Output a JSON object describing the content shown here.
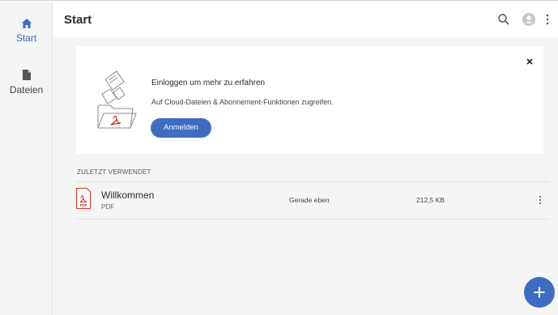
{
  "header": {
    "title": "Start",
    "search_icon": "search-icon",
    "avatar_icon": "avatar-icon",
    "more_icon": "more-vertical-icon"
  },
  "sidebar": {
    "items": [
      {
        "label": "Start",
        "icon": "home-icon",
        "active": true
      },
      {
        "label": "Dateien",
        "icon": "document-icon",
        "active": false
      }
    ]
  },
  "signin_card": {
    "title": "Einloggen um mehr zu erfahren",
    "subtitle": "Auf Cloud-Dateien & Abonnement-Funktionen zugreifen.",
    "button_label": "Anmelden",
    "close_icon": "close-icon"
  },
  "recent": {
    "section_label": "ZULETZT VERWENDET",
    "files": [
      {
        "name": "Willkommen",
        "type": "PDF",
        "modified": "Gerade eben",
        "size": "212,5 KB"
      }
    ]
  },
  "fab": {
    "icon": "plus-icon"
  },
  "colors": {
    "accent": "#3e6cc0",
    "pdf_red": "#d93025",
    "sidebar_bg": "#f4f4f4",
    "main_bg": "#f5f5f5"
  }
}
